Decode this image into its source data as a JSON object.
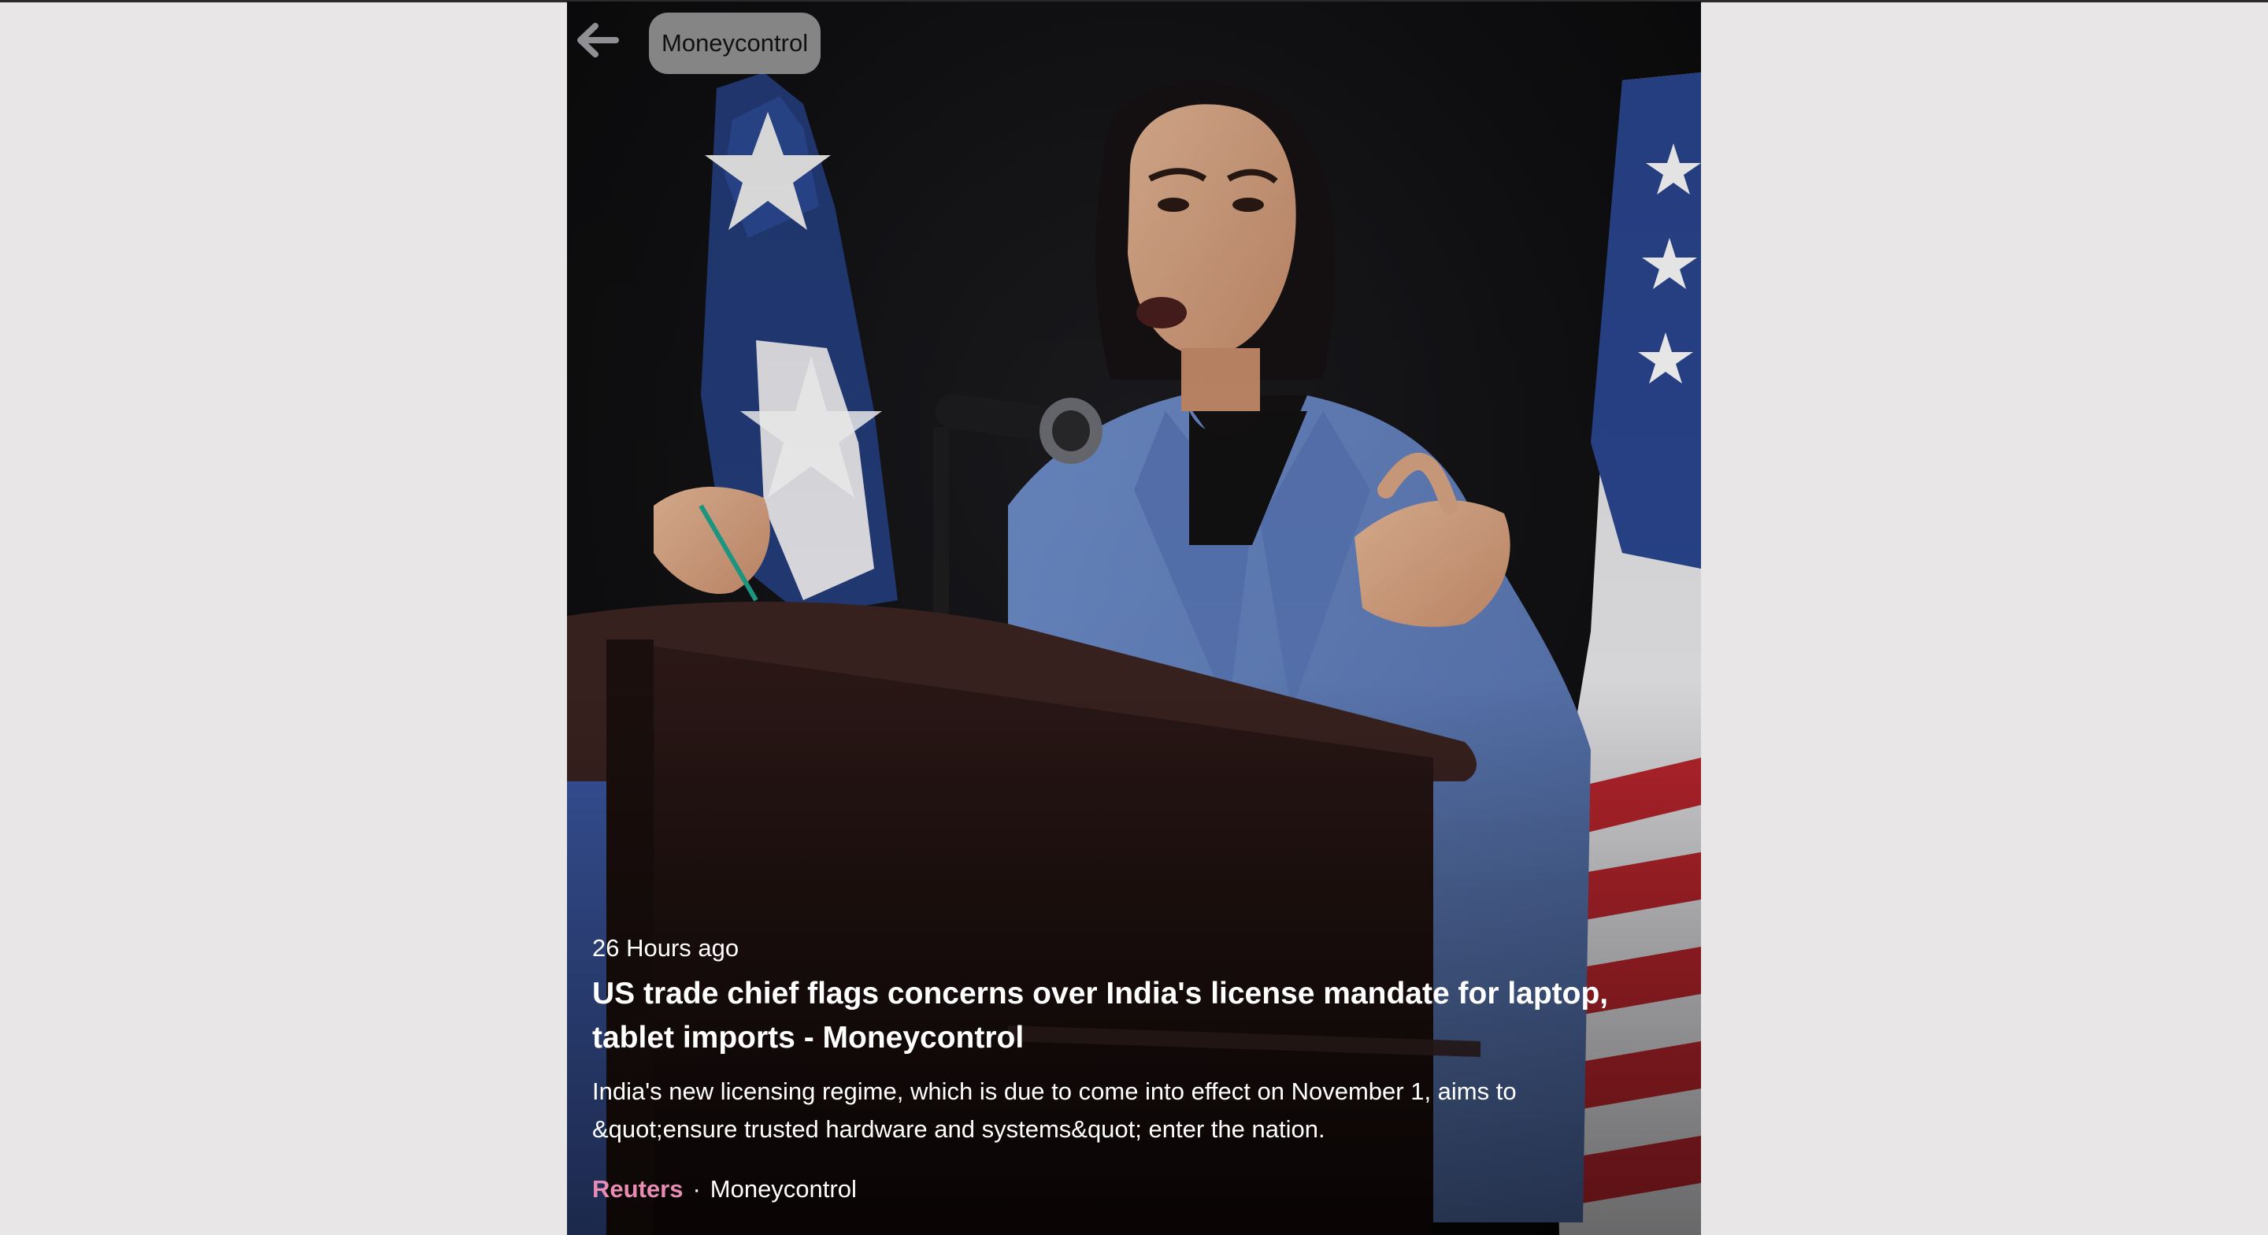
{
  "header": {
    "source_pill": "Moneycontrol"
  },
  "icons": {
    "back": "arrow-left-icon"
  },
  "article": {
    "timestamp": "26 Hours ago",
    "headline": "US trade chief flags concerns over India's license mandate for laptop, tablet imports - Moneycontrol",
    "summary": "India's new licensing regime, which is due to come into effect on November 1, aims to &quot;ensure trusted hardware and systems&quot; enter the nation.",
    "author": "Reuters",
    "separator": "·",
    "publisher": "Moneycontrol"
  },
  "colors": {
    "author_accent": "#e88cb3",
    "pill_bg": "#a0a0a0",
    "page_bg": "#e8e6e7"
  }
}
